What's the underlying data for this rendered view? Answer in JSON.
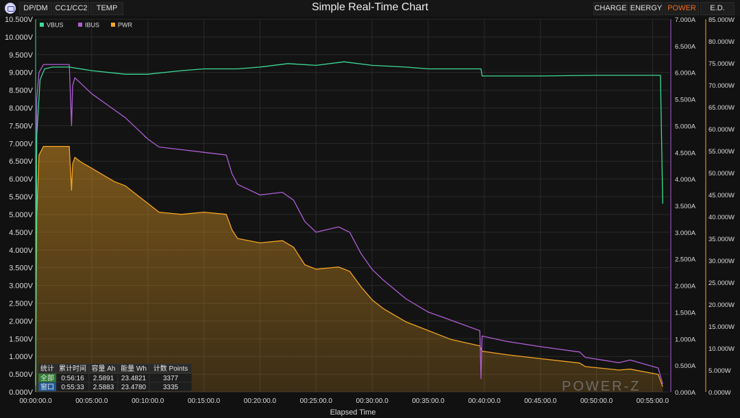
{
  "left_tabs": [
    "DP/DM",
    "CC1/CC2",
    "TEMP"
  ],
  "title": "Simple Real-Time Chart",
  "right_tabs": [
    "CHARGE",
    "ENERGY",
    "POWER",
    "E.D."
  ],
  "active_right_tab": "POWER",
  "watermark": "POWER-Z",
  "colors": {
    "vbus": "#3ddc97",
    "ibus": "#b05ed6",
    "pwr": "#f5a623",
    "background": "#111111",
    "plot_bg": "#131313"
  },
  "stats": {
    "headers": [
      "统计",
      "累计时间",
      "容量 Ah",
      "能量 Wh",
      "计数 Points"
    ],
    "rows": [
      [
        "全部",
        "0:56:16",
        "2.5891",
        "23.4821",
        "3377"
      ],
      [
        "窗口",
        "0:55:33",
        "2.5883",
        "23.4780",
        "3335"
      ]
    ]
  },
  "chart_data": {
    "type": "line",
    "xlabel": "Elapsed Time",
    "x_unit": "minutes",
    "xlim": [
      0,
      56.5
    ],
    "x_ticks": [
      "00:00:00.0",
      "00:05:00.0",
      "00:10:00.0",
      "00:15:00.0",
      "00:20:00.0",
      "00:25:00.0",
      "00:30:00.0",
      "00:35:00.0",
      "00:40:00.0",
      "00:45:00.0",
      "00:50:00.0",
      "00:55:00.0"
    ],
    "y_left": {
      "range": [
        0,
        10.5
      ],
      "ticks": [
        "0.000V",
        "0.500V",
        "1.000V",
        "1.500V",
        "2.000V",
        "2.500V",
        "3.000V",
        "3.500V",
        "4.000V",
        "4.500V",
        "5.000V",
        "5.500V",
        "6.000V",
        "6.500V",
        "7.000V",
        "7.500V",
        "8.000V",
        "8.500V",
        "9.000V",
        "9.500V",
        "10.000V",
        "10.500V"
      ]
    },
    "y_right1": {
      "range": [
        0,
        7.0
      ],
      "ticks": [
        "0.000A",
        "0.500A",
        "1.000A",
        "1.500A",
        "2.000A",
        "2.500A",
        "3.000A",
        "3.500A",
        "4.000A",
        "4.500A",
        "5.000A",
        "5.500A",
        "6.000A",
        "6.500A",
        "7.000A"
      ]
    },
    "y_right2": {
      "range": [
        0,
        85
      ],
      "ticks": [
        "0.000W",
        "5.000W",
        "10.000W",
        "15.000W",
        "20.000W",
        "25.000W",
        "30.000W",
        "35.000W",
        "40.000W",
        "45.000W",
        "50.000W",
        "55.000W",
        "60.000W",
        "65.000W",
        "70.000W",
        "75.000W",
        "80.000W",
        "85.000W"
      ]
    },
    "legend": "top-left",
    "grid": true,
    "series": [
      {
        "name": "VBUS",
        "unit": "V",
        "x": [
          0,
          0.1,
          0.4,
          0.8,
          1.5,
          3,
          5,
          8,
          10,
          13,
          15,
          18,
          20,
          22.5,
          25,
          27.5,
          30,
          33,
          35,
          39.7,
          39.8,
          45,
          50,
          55.7,
          55.9
        ],
        "y": [
          0.2,
          7.2,
          8.8,
          9.1,
          9.15,
          9.15,
          9.05,
          8.95,
          8.95,
          9.05,
          9.1,
          9.1,
          9.15,
          9.25,
          9.2,
          9.3,
          9.2,
          9.15,
          9.1,
          9.1,
          8.9,
          8.9,
          8.92,
          8.92,
          5.3
        ]
      },
      {
        "name": "IBUS",
        "unit": "A",
        "x": [
          0,
          0.1,
          0.3,
          0.7,
          3,
          3.2,
          3.3,
          3.5,
          4,
          5,
          7,
          8,
          9,
          10,
          11,
          13,
          15,
          17,
          17.5,
          18,
          20,
          22,
          23,
          24,
          25,
          27,
          28,
          29,
          30,
          31,
          33,
          35,
          37,
          39.6,
          39.7,
          39.8,
          42,
          45,
          48.5,
          49,
          52,
          53,
          55.5,
          55.9
        ],
        "y": [
          0.2,
          5.5,
          6.0,
          6.15,
          6.15,
          5.0,
          5.75,
          5.9,
          5.8,
          5.6,
          5.3,
          5.15,
          4.95,
          4.75,
          4.6,
          4.55,
          4.5,
          4.45,
          4.1,
          3.9,
          3.7,
          3.75,
          3.6,
          3.2,
          3.0,
          3.1,
          3.0,
          2.6,
          2.3,
          2.1,
          1.75,
          1.5,
          1.35,
          1.15,
          0.25,
          1.05,
          0.95,
          0.85,
          0.75,
          0.65,
          0.55,
          0.6,
          0.45,
          0.15
        ]
      },
      {
        "name": "PWR",
        "unit": "W",
        "x": [
          0,
          0.1,
          0.3,
          0.7,
          3,
          3.2,
          3.3,
          3.5,
          4,
          5,
          7,
          8,
          9,
          10,
          11,
          13,
          15,
          17,
          17.5,
          18,
          20,
          22,
          23,
          24,
          25,
          27,
          28,
          29,
          30,
          31,
          33,
          35,
          37,
          39.6,
          39.8,
          42,
          45,
          48.5,
          49,
          52,
          53,
          55.5,
          55.9
        ],
        "y": [
          1.5,
          40,
          54,
          56,
          56,
          46,
          52,
          53.5,
          52.5,
          51,
          48,
          47,
          45,
          43,
          41,
          40.5,
          41,
          40.5,
          37,
          35,
          34,
          34.5,
          33,
          29,
          28,
          28.5,
          27.5,
          24,
          21,
          19,
          16,
          14,
          12,
          10.5,
          9.3,
          8.5,
          7.6,
          6.6,
          5.8,
          5,
          5.2,
          4,
          1.2
        ]
      }
    ]
  }
}
